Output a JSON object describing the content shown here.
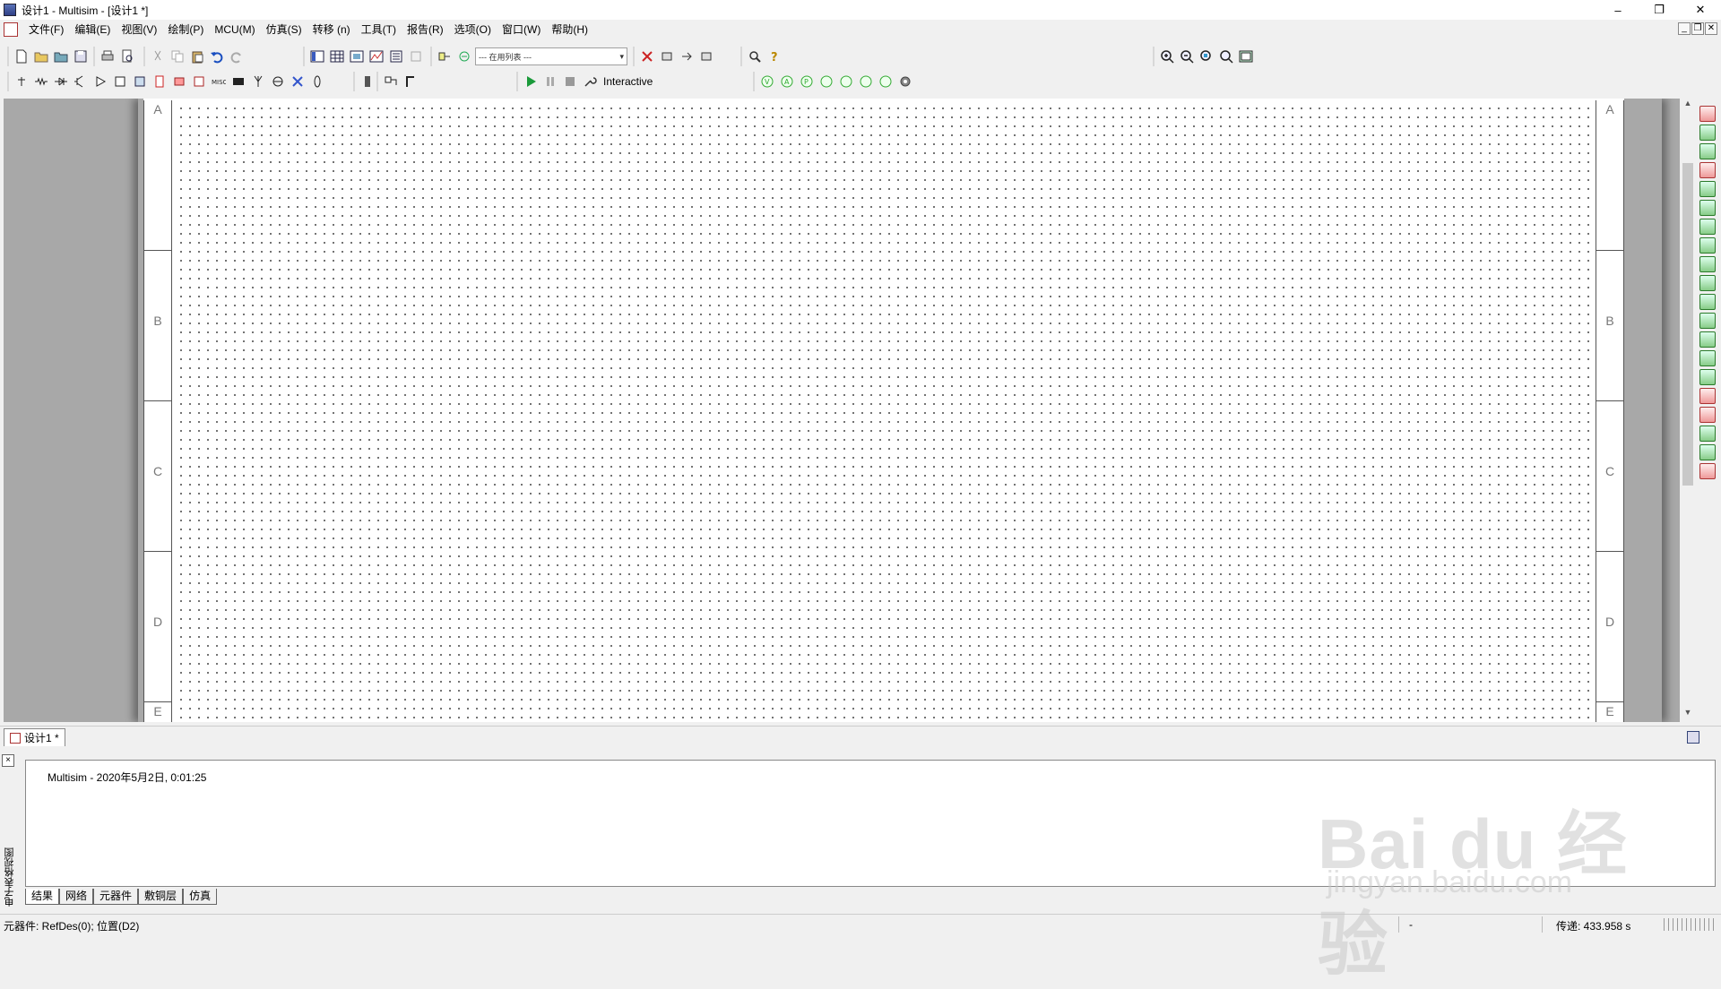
{
  "window": {
    "title": "设计1 - Multisim - [设计1 *]",
    "controls": [
      "–",
      "❐",
      "✕"
    ]
  },
  "menu": {
    "items": [
      "文件(F)",
      "编辑(E)",
      "视图(V)",
      "绘制(P)",
      "MCU(M)",
      "仿真(S)",
      "转移 (n)",
      "工具(T)",
      "报告(R)",
      "选项(O)",
      "窗口(W)",
      "帮助(H)"
    ],
    "mdi_controls": [
      "_",
      "❐",
      "✕"
    ]
  },
  "toolbar": {
    "in_use_list": "--- 在用列表 ---",
    "sim_mode": "Interactive"
  },
  "sheet": {
    "zones": [
      "A",
      "B",
      "C",
      "D",
      "E"
    ]
  },
  "tabs": {
    "design": "设计1 *"
  },
  "panel": {
    "title": "电子表格视图",
    "log": "Multisim  -  2020年5月2日, 0:01:25",
    "tabs": [
      "结果",
      "网络",
      "元器件",
      "敷铜层",
      "仿真"
    ]
  },
  "statusbar": {
    "left": "元器件: RefDes(0); 位置(D2)",
    "mid": "-",
    "right": "传递: 433.958 s"
  },
  "watermark": {
    "big": "Bai du 经验",
    "small": "jingyan.baidu.com"
  }
}
